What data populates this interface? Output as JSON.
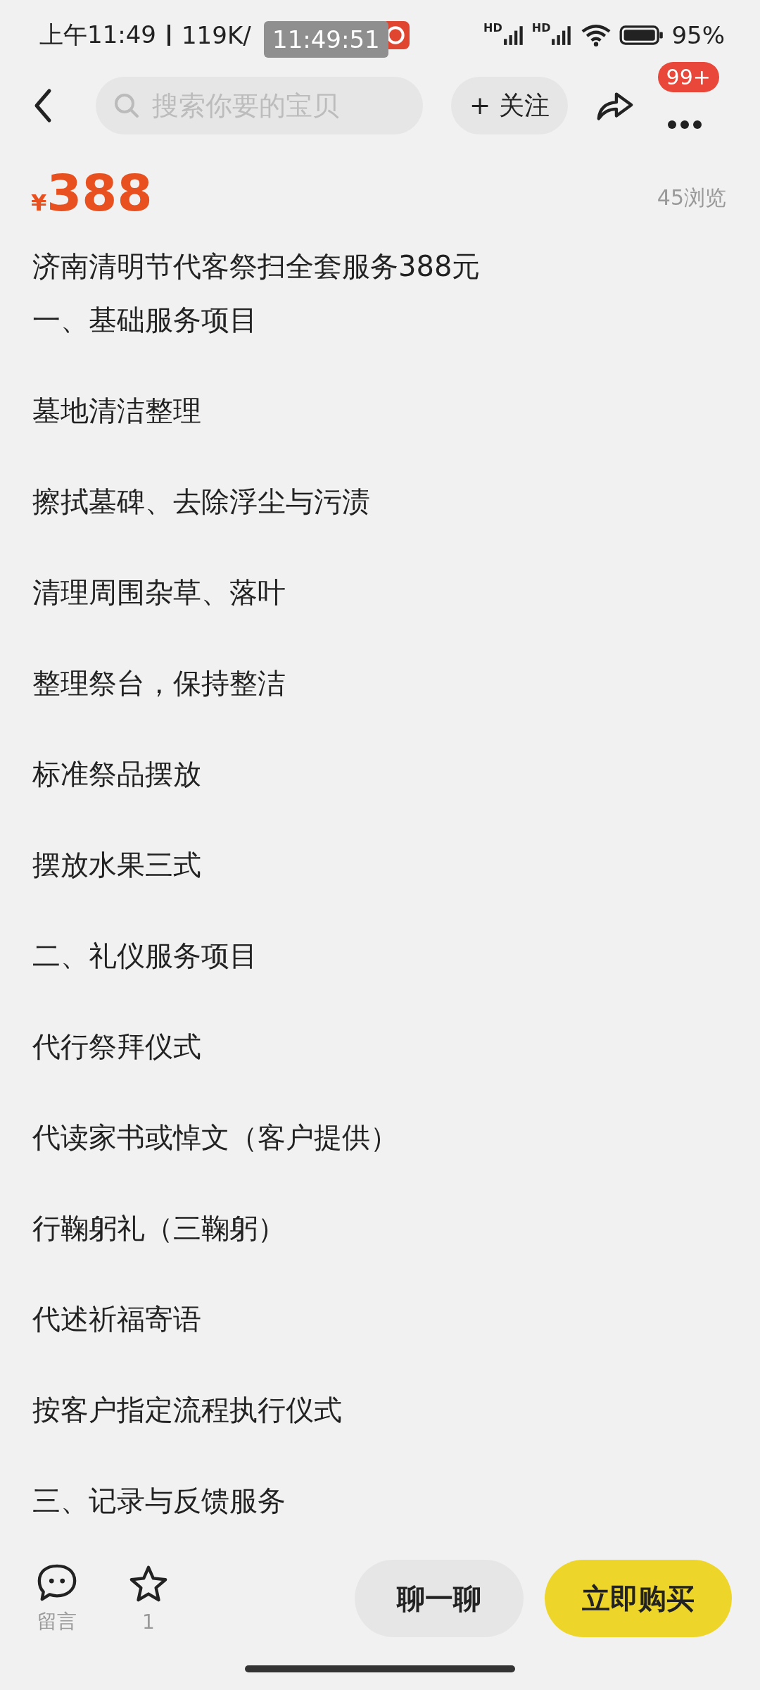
{
  "status_bar": {
    "time": "上午11:49",
    "speed": "119K/",
    "overlay_time": "11:49:51",
    "network_labels": [
      "HD",
      "HD"
    ],
    "battery": "95%"
  },
  "nav": {
    "search_placeholder": "搜索你要的宝贝",
    "follow": "+ 关注",
    "badge": "99+"
  },
  "price": {
    "currency": "¥",
    "amount": "388",
    "views": "45浏览"
  },
  "description": [
    "济南清明节代客祭扫全套服务388元",
    "一、基础服务项目",
    "墓地清洁整理",
    "擦拭墓碑、去除浮尘与污渍",
    "清理周围杂草、落叶",
    "整理祭台，保持整洁",
    "标准祭品摆放",
    "摆放水果三式",
    "二、礼仪服务项目",
    "代行祭拜仪式",
    "代读家书或悼文（客户提供）",
    "行鞠躬礼（三鞠躬）",
    "代述祈福寄语",
    "按客户指定流程执行仪式",
    "三、记录与反馈服务"
  ],
  "bottom_bar": {
    "comment_label": "留言",
    "favorite_count": "1",
    "chat": "聊一聊",
    "buy": "立即购买"
  }
}
